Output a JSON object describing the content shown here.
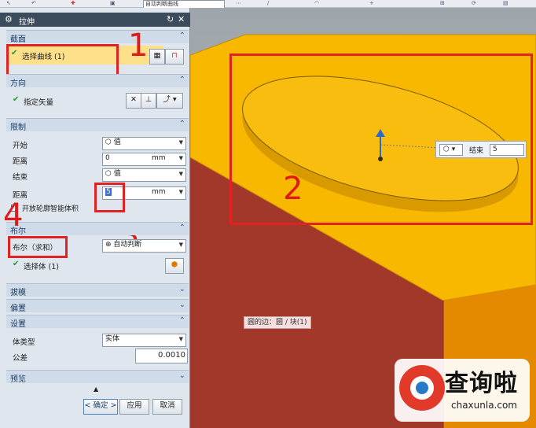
{
  "toolbar": {
    "filter_value": "自动判断曲线"
  },
  "dialog": {
    "title": "拉伸",
    "section_profile": {
      "title": "截面",
      "select_curve": "选择曲线 (1)"
    },
    "section_direction": {
      "title": "方向",
      "specify_vector": "指定矢量"
    },
    "section_limits": {
      "title": "限制",
      "start_label": "开始",
      "start_value": "值",
      "distance_label": "距离",
      "distance_value": "0",
      "end_label": "结束",
      "end_value": "值",
      "end_distance_label": "距离",
      "end_distance_value": "5",
      "unit": "mm",
      "open_profile": "开放轮廓智能体积"
    },
    "section_boolean": {
      "title": "布尔",
      "label": "布尔（求和）",
      "value": "自动判断",
      "select_body": "选择体 (1)"
    },
    "section_draft": {
      "title": "拔模"
    },
    "section_offset": {
      "title": "偏置"
    },
    "section_settings": {
      "title": "设置",
      "body_type_label": "体类型",
      "body_type_value": "实体",
      "tolerance_label": "公差",
      "tolerance_value": "0.0010"
    },
    "section_preview": {
      "title": "预览"
    },
    "buttons": {
      "ok": "< 确定 >",
      "apply": "应用",
      "cancel": "取消"
    }
  },
  "viewport": {
    "handle_label": "结束",
    "handle_value": "5",
    "tooltip": "圆的边：圆 / 块(1)"
  },
  "annotations": {
    "n1": "1",
    "n2": "2",
    "n3": "3",
    "n4": "4"
  },
  "watermark": {
    "brand": "查询啦",
    "url": "chaxunla.com"
  },
  "colors": {
    "block_top": "#f8b800",
    "block_front": "#a2382a",
    "block_side": "#e58a00",
    "accent_red": "#e02222"
  }
}
